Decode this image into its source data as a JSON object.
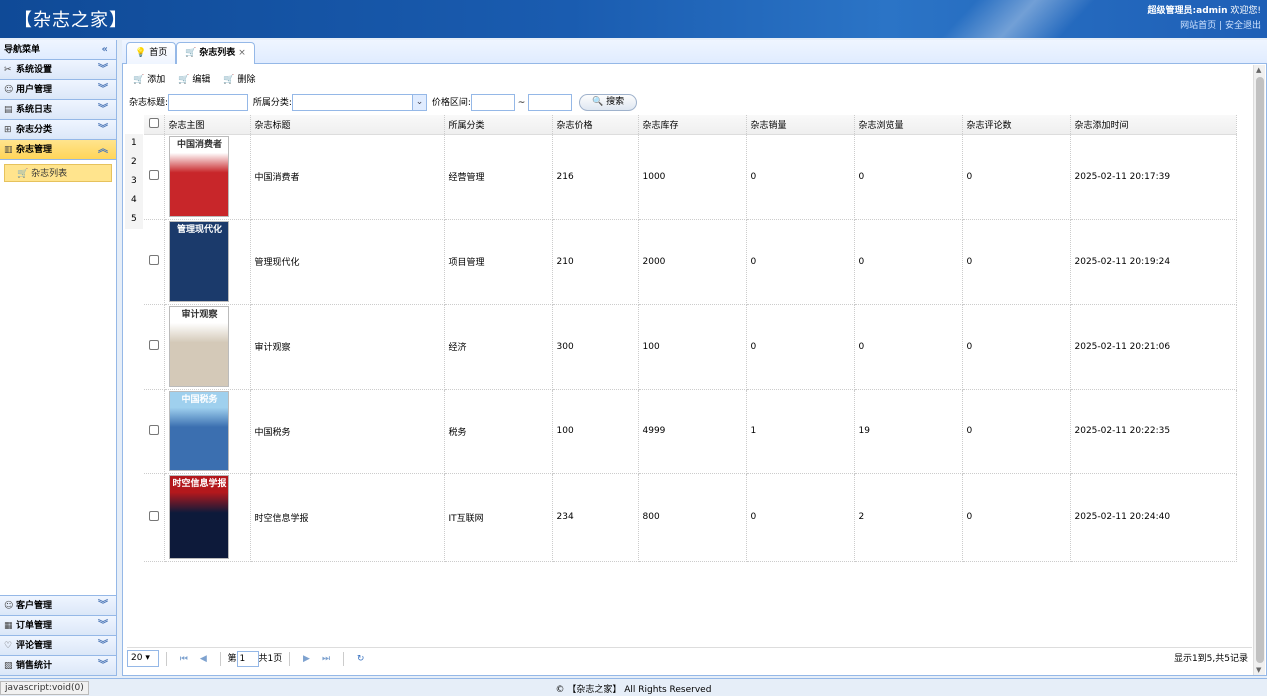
{
  "header": {
    "title": "【杂志之家】",
    "user_prefix": "超级管理员:",
    "user_name": "admin",
    "welcome": "欢迎您!",
    "site_home": "网站首页",
    "divider": "|",
    "logout": "安全退出"
  },
  "sidebar": {
    "title": "导航菜单",
    "collapse_icon": "«",
    "top_items": [
      {
        "label": "系统设置",
        "icon": "tools-icon"
      },
      {
        "label": "用户管理",
        "icon": "users-icon"
      },
      {
        "label": "系统日志",
        "icon": "log-icon"
      },
      {
        "label": "杂志分类",
        "icon": "category-icon"
      },
      {
        "label": "杂志管理",
        "icon": "magazine-icon",
        "open": true
      }
    ],
    "open_sub_item": "杂志列表",
    "bottom_items": [
      {
        "label": "客户管理",
        "icon": "customer-icon"
      },
      {
        "label": "订单管理",
        "icon": "order-icon"
      },
      {
        "label": "评论管理",
        "icon": "comment-icon"
      },
      {
        "label": "销售统计",
        "icon": "chart-icon"
      }
    ]
  },
  "tabs": [
    {
      "label": "首页",
      "icon": "lightbulb-icon",
      "active": false
    },
    {
      "label": "杂志列表",
      "icon": "cart-icon",
      "active": true,
      "close": "×"
    }
  ],
  "toolbar": {
    "add": "添加",
    "edit": "编辑",
    "delete": "删除"
  },
  "search": {
    "title_label": "杂志标题:",
    "title_value": "",
    "category_label": "所属分类:",
    "category_value": "",
    "price_label": "价格区间:",
    "price_min": "",
    "price_sep": "~",
    "price_max": "",
    "button": "搜索"
  },
  "grid": {
    "columns": [
      "杂志主图",
      "杂志标题",
      "所属分类",
      "杂志价格",
      "杂志库存",
      "杂志销量",
      "杂志浏览量",
      "杂志评论数",
      "杂志添加时间"
    ],
    "row_numbers": [
      "1",
      "2",
      "3",
      "4",
      "5"
    ],
    "rows": [
      {
        "cover_text": "中国消费者",
        "cover_bg": "#c8262a",
        "cover_top": "#ffffff",
        "title": "中国消费者",
        "category": "经营管理",
        "price": "216",
        "stock": "1000",
        "sales": "0",
        "views": "0",
        "comments": "0",
        "time": "2025-02-11 20:17:39"
      },
      {
        "cover_text": "管理现代化",
        "cover_bg": "#1b3a6b",
        "cover_top": "#1b3a6b",
        "title": "管理现代化",
        "category": "项目管理",
        "price": "210",
        "stock": "2000",
        "sales": "0",
        "views": "0",
        "comments": "0",
        "time": "2025-02-11 20:19:24"
      },
      {
        "cover_text": "审计观察",
        "cover_bg": "#d4c9b8",
        "cover_top": "#ffffff",
        "title": "审计观察",
        "category": "经济",
        "price": "300",
        "stock": "100",
        "sales": "0",
        "views": "0",
        "comments": "0",
        "time": "2025-02-11 20:21:06"
      },
      {
        "cover_text": "中国税务",
        "cover_bg": "#3b6fb0",
        "cover_top": "#9fd0ee",
        "title": "中国税务",
        "category": "税务",
        "price": "100",
        "stock": "4999",
        "sales": "1",
        "views": "19",
        "comments": "0",
        "time": "2025-02-11 20:22:35"
      },
      {
        "cover_text": "时空信息学报",
        "cover_bg": "#0d1a3a",
        "cover_top": "#b3181c",
        "title": "时空信息学报",
        "category": "IT互联网",
        "price": "234",
        "stock": "800",
        "sales": "0",
        "views": "2",
        "comments": "0",
        "time": "2025-02-11 20:24:40"
      }
    ]
  },
  "pager": {
    "page_size": "20",
    "page_prefix": "第",
    "page_value": "1",
    "page_total": "共1页",
    "info": "显示1到5,共5记录"
  },
  "statusbar": {
    "url": "javascript:void(0)",
    "copyright": "© 【杂志之家】 All Rights Reserved"
  }
}
